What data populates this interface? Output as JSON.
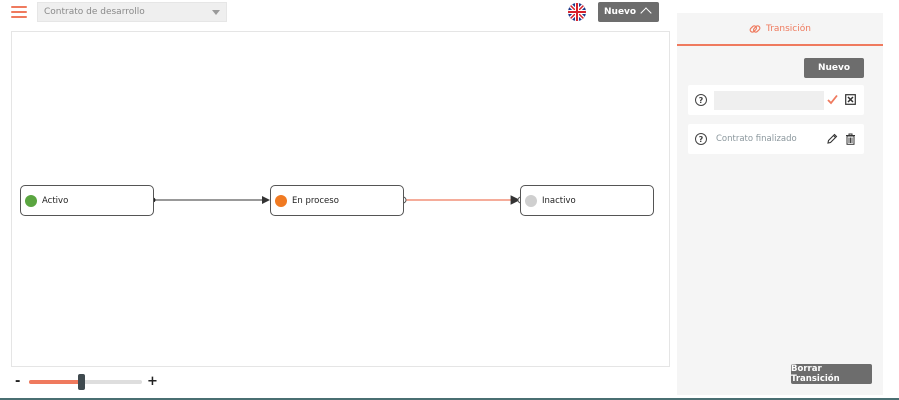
{
  "topbar": {
    "menu_icon": "hamburger-icon",
    "process_select_value": "Contrato de desarrollo",
    "language_flag": "uk-flag-icon",
    "nuevo_label": "Nuevo"
  },
  "diagram": {
    "nodes": [
      {
        "label": "Activo",
        "color": "#5aa540"
      },
      {
        "label": "En proceso",
        "color": "#f07a22"
      },
      {
        "label": "Inactivo",
        "color": "#cfcfcf"
      }
    ],
    "edges": [
      {
        "from": "Activo",
        "to": "En proceso",
        "color": "#333333"
      },
      {
        "from": "En proceso",
        "to": "Inactivo",
        "color": "#ef7a5e"
      }
    ]
  },
  "zoom": {
    "minus_label": "-",
    "plus_label": "+",
    "level": 0.46
  },
  "panel": {
    "header_title": "Transición",
    "header_icon": "link-icon",
    "nuevo_label": "Nuevo",
    "new_row_value": "",
    "items": [
      {
        "label": "Contrato finalizado"
      }
    ],
    "borrar_label": "Borrar Transición"
  },
  "colors": {
    "accent": "#ef7a5e",
    "button": "#6d6d6d"
  }
}
